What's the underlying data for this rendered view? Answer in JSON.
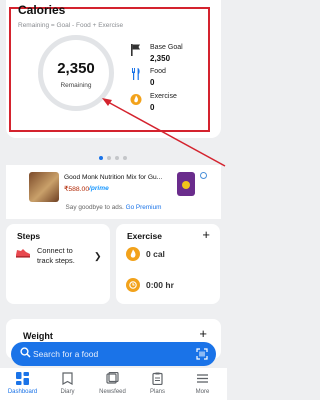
{
  "calories": {
    "title": "Calories",
    "formula": "Remaining = Goal - Food + Exercise",
    "remaining_value": "2,350",
    "remaining_label": "Remaining",
    "base_goal_label": "Base Goal",
    "base_goal_value": "2,350",
    "food_label": "Food",
    "food_value": "0",
    "exercise_label": "Exercise",
    "exercise_value": "0"
  },
  "carousel": {
    "pages": 4,
    "active": 0
  },
  "ad": {
    "title": "Good Monk Nutrition Mix for Gu...",
    "price": "₹588.00",
    "prime": "/prime",
    "footer_text": "Say goodbye to ads.",
    "footer_link": "Go Premium"
  },
  "steps": {
    "title": "Steps",
    "message": "Connect to track steps."
  },
  "exercise": {
    "title": "Exercise",
    "calories": "0 cal",
    "duration": "0:00 hr"
  },
  "weight": {
    "title": "Weight"
  },
  "search": {
    "placeholder": "Search for a food"
  },
  "nav": [
    {
      "label": "Dashboard",
      "icon": "dashboard-icon",
      "active": true
    },
    {
      "label": "Diary",
      "icon": "diary-icon"
    },
    {
      "label": "Newsfeed",
      "icon": "newsfeed-icon"
    },
    {
      "label": "Plans",
      "icon": "plans-icon"
    },
    {
      "label": "More",
      "icon": "menu-icon"
    }
  ],
  "colors": {
    "accent": "#1a73e8",
    "highlight": "#d4232e",
    "exercise": "#f2a21b"
  }
}
